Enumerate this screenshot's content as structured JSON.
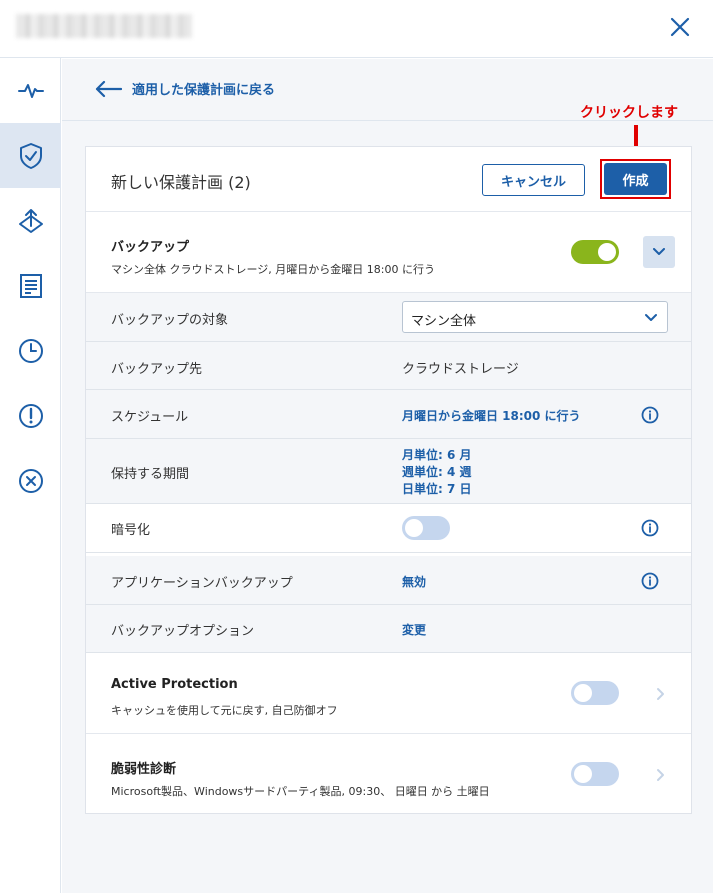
{
  "window": {
    "close_icon": "close-icon"
  },
  "sidebar": {
    "items": [
      {
        "name": "activity",
        "icon": "pulse-icon"
      },
      {
        "name": "protection",
        "icon": "shield-check-icon",
        "active": true
      },
      {
        "name": "recovery",
        "icon": "upload-diamond-icon"
      },
      {
        "name": "reports",
        "icon": "document-list-icon"
      },
      {
        "name": "history",
        "icon": "clock-icon"
      },
      {
        "name": "alerts",
        "icon": "alert-circle-icon"
      },
      {
        "name": "remove",
        "icon": "x-circle-icon"
      }
    ]
  },
  "back_link": {
    "label": "適用した保護計画に戻る"
  },
  "annotation": {
    "label": "クリックします",
    "color": "#e00000"
  },
  "plan": {
    "title": "新しい保護計画 (2)",
    "cancel_label": "キャンセル",
    "create_label": "作成"
  },
  "backup": {
    "title": "バックアップ",
    "description": "マシン全体 クラウドストレージ, 月曜日から金曜日 18:00 に行う",
    "enabled": true,
    "rows": {
      "target_label": "バックアップの対象",
      "target_value": "マシン全体",
      "destination_label": "バックアップ先",
      "destination_value": "クラウドストレージ",
      "schedule_label": "スケジュール",
      "schedule_value": "月曜日から金曜日 18:00 に行う",
      "retention_label": "保持する期間",
      "retention_lines": [
        "月単位: 6 月",
        "週単位: 4 週",
        "日単位: 7 日"
      ],
      "encryption_label": "暗号化",
      "encryption_enabled": false,
      "app_backup_label": "アプリケーションバックアップ",
      "app_backup_value": "無効",
      "options_label": "バックアップオプション",
      "options_value": "変更"
    }
  },
  "active_protection": {
    "title": "Active Protection",
    "description": "キャッシュを使用して元に戻す, 自己防御オフ",
    "enabled": false
  },
  "vulnerability": {
    "title": "脆弱性診断",
    "description": "Microsoft製品、Windowsサードパーティ製品, 09:30、 日曜日 から 土曜日",
    "enabled": false
  },
  "colors": {
    "accent": "#1d5fa8",
    "toggle_on": "#8ab51c",
    "toggle_off": "#c5d6ee",
    "highlight": "#e00000"
  }
}
